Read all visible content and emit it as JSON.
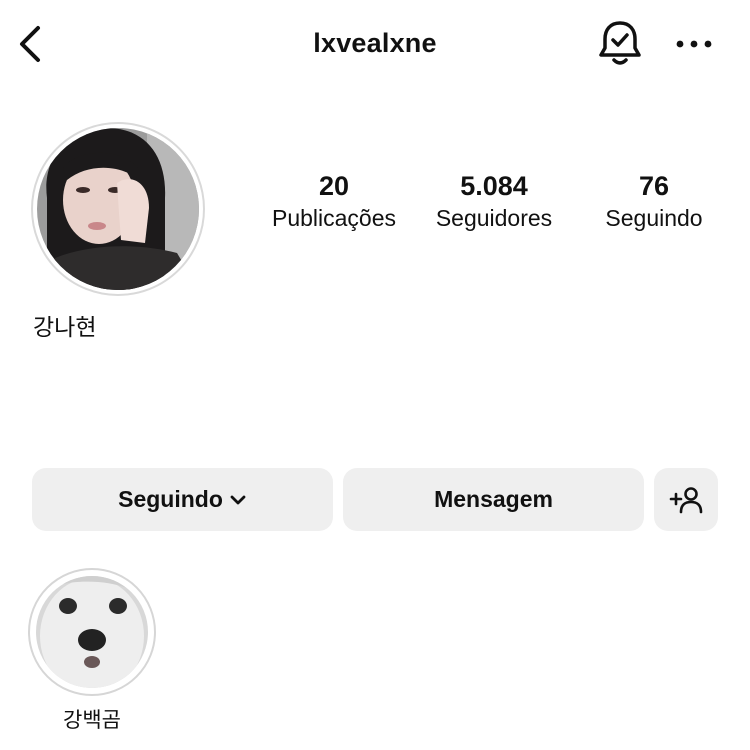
{
  "header": {
    "username": "lxvealxne",
    "icons": [
      "back-arrow-icon",
      "notification-bell-icon",
      "more-options-icon"
    ]
  },
  "profile": {
    "display_name": "강나현",
    "stats": {
      "posts": {
        "count": "20",
        "label": "Publicações"
      },
      "followers": {
        "count": "5.084",
        "label": "Seguidores"
      },
      "following": {
        "count": "76",
        "label": "Seguindo"
      }
    }
  },
  "actions": {
    "following_label": "Seguindo",
    "message_label": "Mensagem",
    "suggest_icon": "add-person-icon"
  },
  "highlights": [
    {
      "label": "강백곰"
    }
  ],
  "colors": {
    "button_bg": "#efefef",
    "text": "#111111",
    "ring": "#d9d9d9"
  }
}
